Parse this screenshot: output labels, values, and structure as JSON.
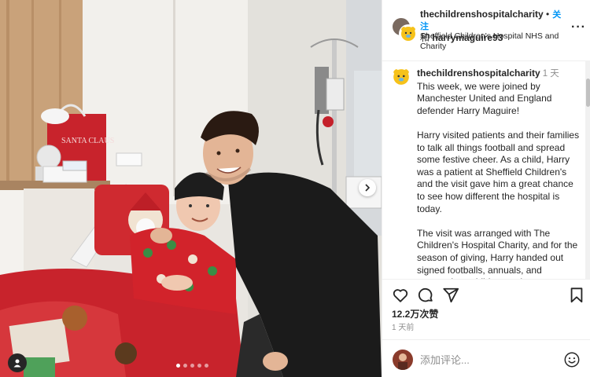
{
  "header": {
    "account1": "thechildrenshospitalcharity",
    "and": "和",
    "account2": "harrymaguire93",
    "follow": "关注",
    "location": "Sheffield Children's Hospital NHS and Charity",
    "more": "···"
  },
  "caption": {
    "username": "thechildrenshospitalcharity",
    "time": "1 天",
    "paragraphs": [
      "This week, we were joined by Manchester United and England defender Harry Maguire!",
      "Harry visited patients and their families to talk all things football and spread some festive cheer. As a child, Harry was a patient at Sheffield Children's and the visit gave him a great chance to see how different the hospital is today.",
      "The visit was arranged with The Children's Hospital Charity, and for the season of giving, Harry handed out signed footballs, annuals, and postcards to children and parents."
    ]
  },
  "stats": {
    "likes": "12.2万次赞",
    "ago": "1 天前"
  },
  "comment": {
    "placeholder": "添加评论..."
  },
  "photo": {
    "bag_text": "SANTA CLAUS",
    "carousel_count": 5,
    "carousel_active": 1
  },
  "icons": {
    "like": "heart-icon",
    "comment": "comment-icon",
    "share": "send-icon",
    "save": "bookmark-icon",
    "next": "chevron-right-icon",
    "tag": "user-tag-icon",
    "emoji": "emoji-icon"
  },
  "colors": {
    "follow_blue": "#0095f6",
    "secondary_text": "#8e8e8e",
    "border": "#efefef"
  }
}
